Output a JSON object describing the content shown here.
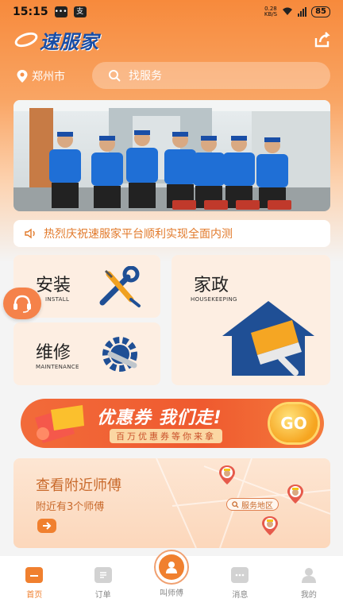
{
  "status_bar": {
    "time": "15:15",
    "net_speed": "0.28\nKB/S",
    "battery": "85"
  },
  "header": {
    "logo": "速服家"
  },
  "location": {
    "city": "郑州市"
  },
  "search": {
    "placeholder": "找服务"
  },
  "notice": {
    "text": "热烈庆祝速服家平台顺利实现全面内测"
  },
  "services": [
    {
      "title": "安装",
      "subtitle": "INSTALL",
      "icon": "screwdriver-wrench-icon"
    },
    {
      "title": "家政",
      "subtitle": "HOUSEKEEPING",
      "icon": "house-brush-icon"
    },
    {
      "title": "维修",
      "subtitle": "MAINTENANCE",
      "icon": "gear-wrench-icon"
    }
  ],
  "coupon": {
    "headline": "优惠券 我们走!",
    "sub": "百万优惠券等你来拿",
    "button": "GO"
  },
  "nearby": {
    "title": "查看附近师傅",
    "count_text": "附近有3个师傅",
    "area_tag": "服务地区"
  },
  "tabbar": [
    {
      "label": "首页",
      "icon": "home-icon",
      "active": true
    },
    {
      "label": "订单",
      "icon": "orders-icon",
      "active": false
    },
    {
      "label": "叫师傅",
      "icon": "worker-icon",
      "active": false
    },
    {
      "label": "消息",
      "icon": "message-icon",
      "active": false
    },
    {
      "label": "我的",
      "icon": "profile-icon",
      "active": false
    }
  ],
  "colors": {
    "accent": "#f0802f",
    "brand_blue": "#1a4ea6",
    "coupon_red": "#ef5a2f"
  }
}
